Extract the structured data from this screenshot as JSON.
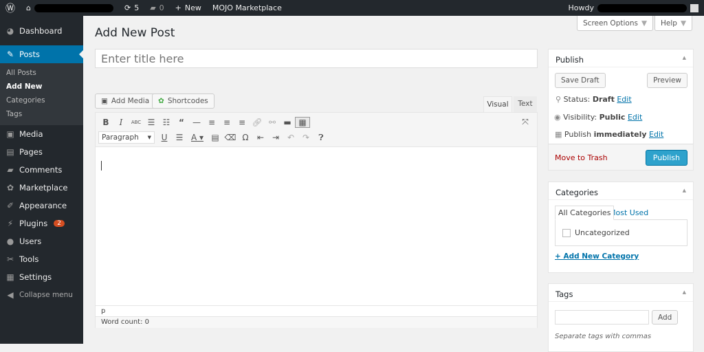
{
  "adminbar": {
    "updates": "5",
    "comments": "0",
    "new": "New",
    "marketplace": "MOJO Marketplace",
    "howdy": "Howdy"
  },
  "sidebar": {
    "items": [
      {
        "label": "Dashboard",
        "icon": "dashboard-icon",
        "g": "◕"
      },
      {
        "label": "Posts",
        "icon": "pin-icon",
        "g": "✎"
      }
    ],
    "submenu": [
      "All Posts",
      "Add New",
      "Categories",
      "Tags"
    ],
    "items2": [
      {
        "label": "Media",
        "icon": "media-icon",
        "g": "▣"
      },
      {
        "label": "Pages",
        "icon": "pages-icon",
        "g": "▤"
      },
      {
        "label": "Comments",
        "icon": "comment-icon",
        "g": "▰"
      },
      {
        "label": "Marketplace",
        "icon": "marketplace-icon",
        "g": "✿"
      },
      {
        "label": "Appearance",
        "icon": "brush-icon",
        "g": "✐"
      },
      {
        "label": "Plugins",
        "icon": "plugin-icon",
        "g": "⚡",
        "badge": "2"
      },
      {
        "label": "Users",
        "icon": "users-icon",
        "g": "●"
      },
      {
        "label": "Tools",
        "icon": "wrench-icon",
        "g": "✂"
      },
      {
        "label": "Settings",
        "icon": "settings-icon",
        "g": "▦"
      }
    ],
    "collapse": "Collapse menu"
  },
  "header": {
    "title": "Add New Post",
    "screen_options": "Screen Options",
    "help": "Help"
  },
  "editor": {
    "title_placeholder": "Enter title here",
    "add_media": "Add Media",
    "shortcodes": "Shortcodes",
    "tab_visual": "Visual",
    "tab_text": "Text",
    "format": "Paragraph",
    "path": "p",
    "word_count_label": "Word count:",
    "word_count": "0"
  },
  "publish": {
    "title": "Publish",
    "save_draft": "Save Draft",
    "preview": "Preview",
    "status_label": "Status:",
    "status": "Draft",
    "visibility_label": "Visibility:",
    "visibility": "Public",
    "publish_label": "Publish",
    "publish_when": "immediately",
    "edit": "Edit",
    "trash": "Move to Trash",
    "publish_button": "Publish"
  },
  "categories": {
    "title": "Categories",
    "tab_all": "All Categories",
    "tab_used": "Most Used",
    "items": [
      "Uncategorized"
    ],
    "add": "+ Add New Category"
  },
  "tags": {
    "title": "Tags",
    "add": "Add",
    "hint": "Separate tags with commas"
  },
  "colors": {
    "accent": "#0073aa",
    "publish_button": "#2ea2cc",
    "sidebar": "#23282d"
  }
}
